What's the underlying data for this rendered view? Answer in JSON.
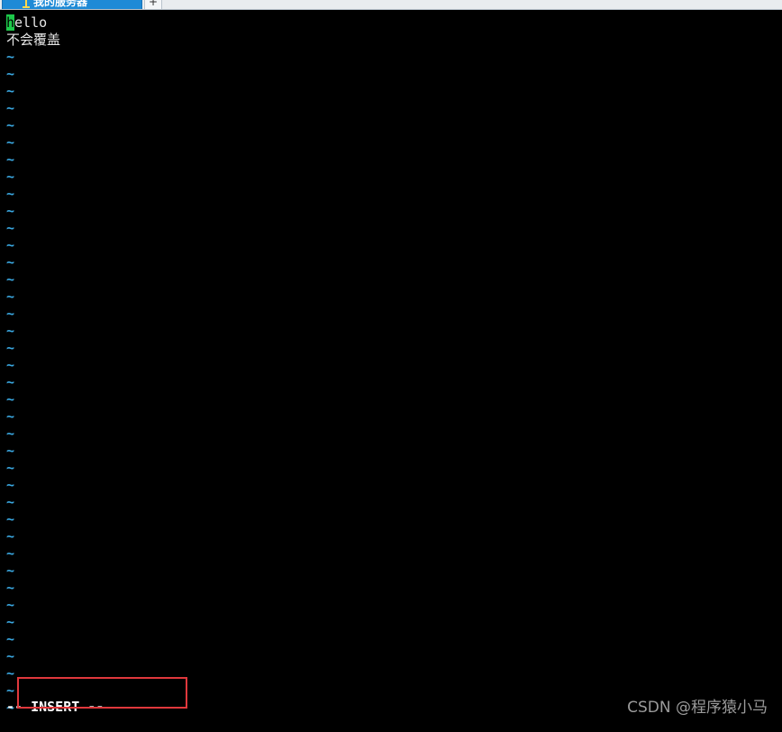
{
  "tabbar": {
    "active_tab_label": "我的服务器",
    "add_tab_label": "+"
  },
  "editor": {
    "lines": [
      "hello",
      "不会覆盖"
    ],
    "cursor_char": "h",
    "first_line_rest": "ello",
    "empty_line_marker": "~",
    "empty_line_count": 39,
    "mode_status": "-- INSERT --"
  },
  "watermark": "CSDN @程序猿小马",
  "colors": {
    "background": "#000000",
    "text": "#e6e6e6",
    "tilde": "#3aa7e0",
    "cursor": "#1dc94a",
    "annotation_box": "#e0383c",
    "tab_active": "#1e8ad6"
  }
}
